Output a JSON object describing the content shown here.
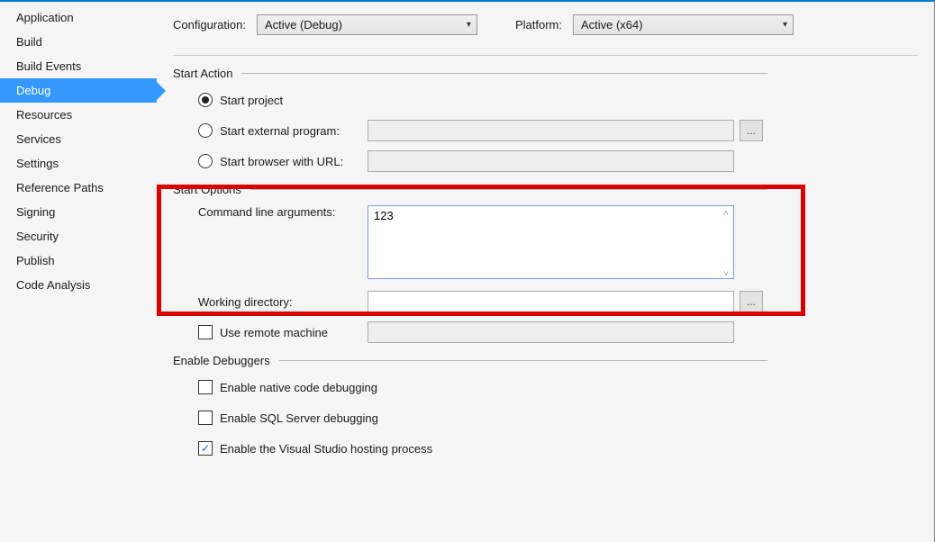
{
  "sidebar": {
    "items": [
      {
        "label": "Application"
      },
      {
        "label": "Build"
      },
      {
        "label": "Build Events"
      },
      {
        "label": "Debug"
      },
      {
        "label": "Resources"
      },
      {
        "label": "Services"
      },
      {
        "label": "Settings"
      },
      {
        "label": "Reference Paths"
      },
      {
        "label": "Signing"
      },
      {
        "label": "Security"
      },
      {
        "label": "Publish"
      },
      {
        "label": "Code Analysis"
      }
    ],
    "selected_index": 3
  },
  "toprow": {
    "config_label": "Configuration:",
    "config_value": "Active (Debug)",
    "platform_label": "Platform:",
    "platform_value": "Active (x64)"
  },
  "start_action": {
    "title": "Start Action",
    "options": {
      "start_project": "Start project",
      "start_external": "Start external program:",
      "start_browser": "Start browser with URL:"
    },
    "selected": "start_project",
    "external_value": "",
    "browser_value": ""
  },
  "start_options": {
    "title": "Start Options",
    "cmd_args_label": "Command line arguments:",
    "cmd_args_value": "123",
    "working_dir_label": "Working directory:",
    "working_dir_value": "",
    "use_remote_label": "Use remote machine",
    "use_remote_checked": false,
    "remote_value": ""
  },
  "enable_debuggers": {
    "title": "Enable Debuggers",
    "native_label": "Enable native code debugging",
    "native_checked": false,
    "sql_label": "Enable SQL Server debugging",
    "sql_checked": false,
    "hosting_label": "Enable the Visual Studio hosting process",
    "hosting_checked": true
  },
  "icons": {
    "ellipsis": "...",
    "checkmark": "✓"
  }
}
